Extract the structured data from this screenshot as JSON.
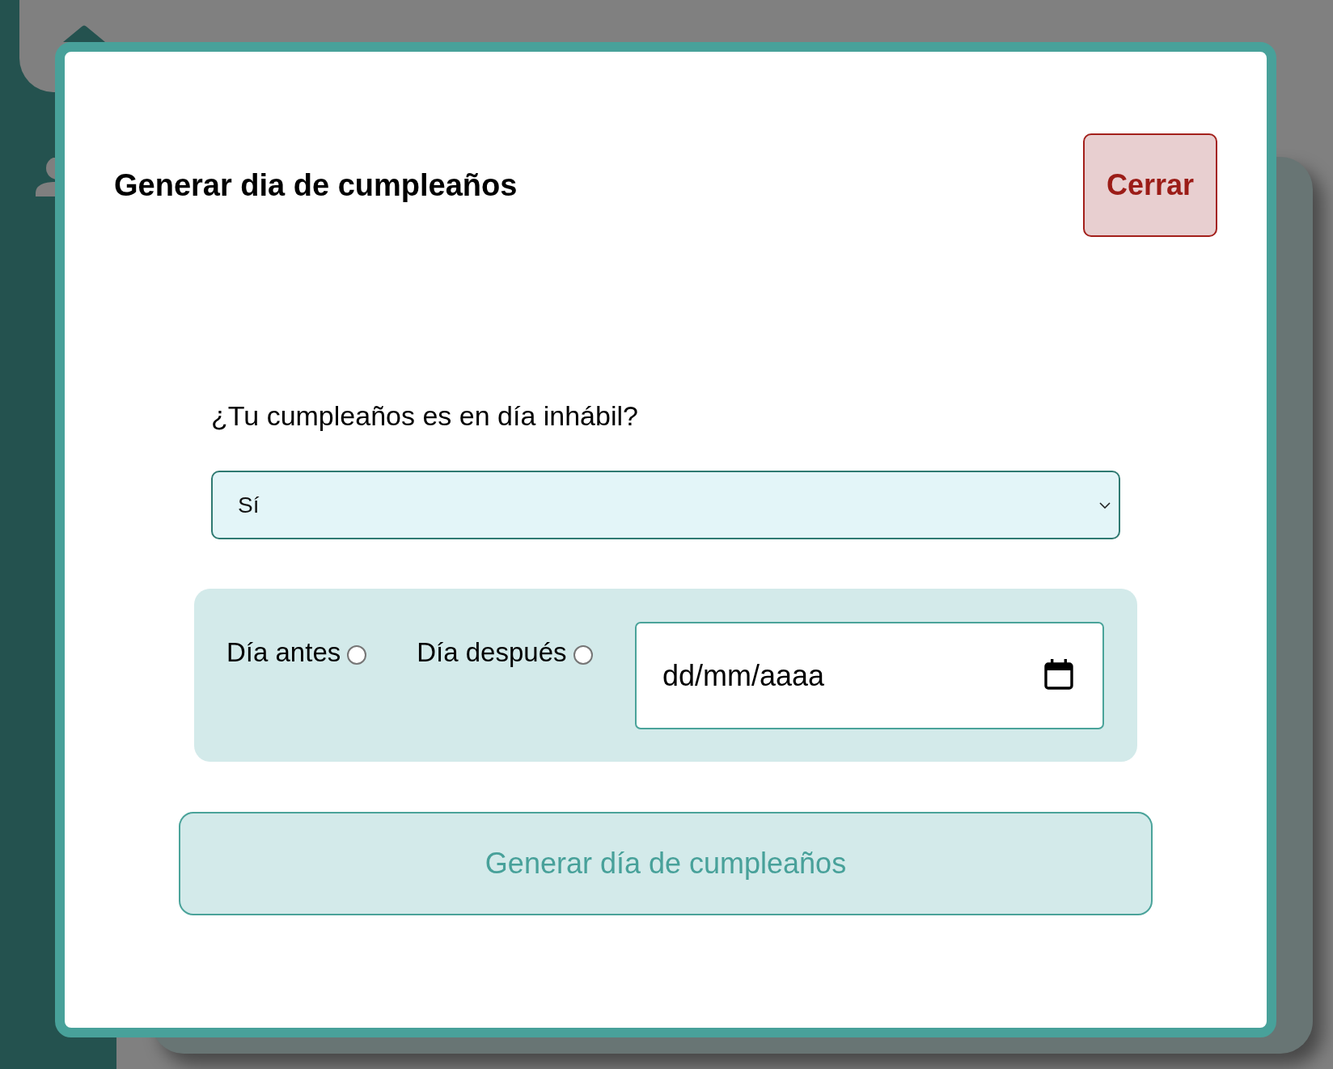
{
  "modal": {
    "title": "Generar dia de cumpleaños",
    "close_button": "Cerrar"
  },
  "form": {
    "question": "¿Tu cumpleaños es en día inhábil?",
    "answer_select": {
      "value": "Sí"
    },
    "options": [
      {
        "label": "Día antes",
        "selected": false
      },
      {
        "label": "Día después",
        "selected": false
      }
    ],
    "date_field": {
      "placeholder": "dd/mm/aaaa"
    },
    "submit_button": "Generar día de cumpleaños"
  }
}
